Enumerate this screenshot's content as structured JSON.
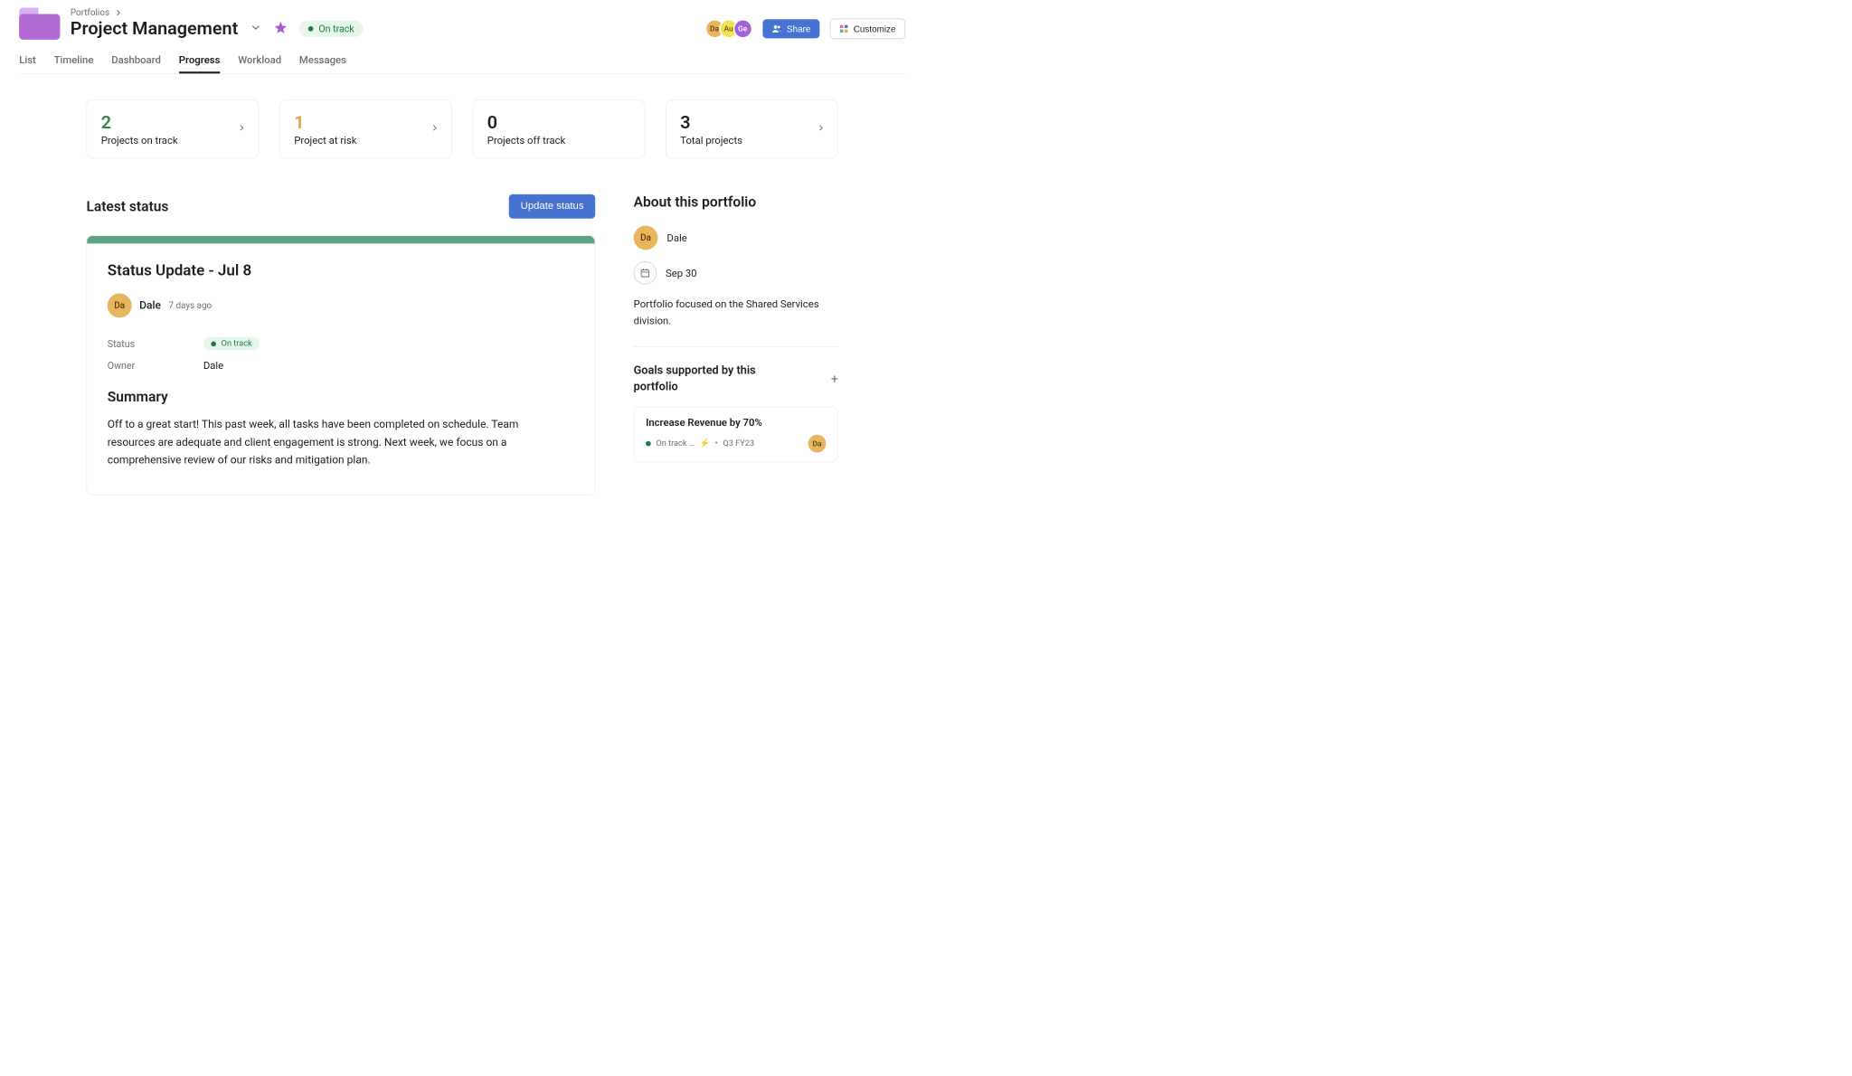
{
  "breadcrumb": {
    "root": "Portfolios"
  },
  "header": {
    "title": "Project Management",
    "status_label": "On track",
    "share_label": "Share",
    "customize_label": "Customize"
  },
  "avatars": [
    {
      "initials": "Da",
      "bg": "#e7b65e"
    },
    {
      "initials": "Au",
      "bg": "#f5e050"
    },
    {
      "initials": "Ge",
      "bg": "#a362d6"
    }
  ],
  "tabs": [
    {
      "label": "List",
      "active": false
    },
    {
      "label": "Timeline",
      "active": false
    },
    {
      "label": "Dashboard",
      "active": false
    },
    {
      "label": "Progress",
      "active": true
    },
    {
      "label": "Workload",
      "active": false
    },
    {
      "label": "Messages",
      "active": false
    }
  ],
  "stats": [
    {
      "value": "2",
      "label": "Projects on track",
      "color": "green",
      "arrow": true
    },
    {
      "value": "1",
      "label": "Project at risk",
      "color": "amber",
      "arrow": true
    },
    {
      "value": "0",
      "label": "Projects off track",
      "color": "",
      "arrow": false
    },
    {
      "value": "3",
      "label": "Total projects",
      "color": "",
      "arrow": true
    }
  ],
  "latest_status": {
    "section_title": "Latest status",
    "update_button": "Update status",
    "title": "Status Update - Jul 8",
    "author_initials": "Da",
    "author_name": "Dale",
    "author_time": "7 days ago",
    "status_field_label": "Status",
    "status_value": "On track",
    "owner_field_label": "Owner",
    "owner_value": "Dale",
    "summary_heading": "Summary",
    "summary_text": "Off to a great start! This past week, all tasks have been completed on schedule. Team resources are adequate and client engagement is strong. Next week, we focus on a comprehensive review of our risks and mitigation plan."
  },
  "about": {
    "section_title": "About this portfolio",
    "owner_initials": "Da",
    "owner_name": "Dale",
    "date": "Sep 30",
    "description": "Portfolio focused on the Shared Services division."
  },
  "goals": {
    "section_title": "Goals supported by this portfolio",
    "goal_title": "Increase Revenue by 70%",
    "goal_status": "On track …",
    "goal_period": "Q3 FY23",
    "goal_owner_initials": "Da"
  }
}
